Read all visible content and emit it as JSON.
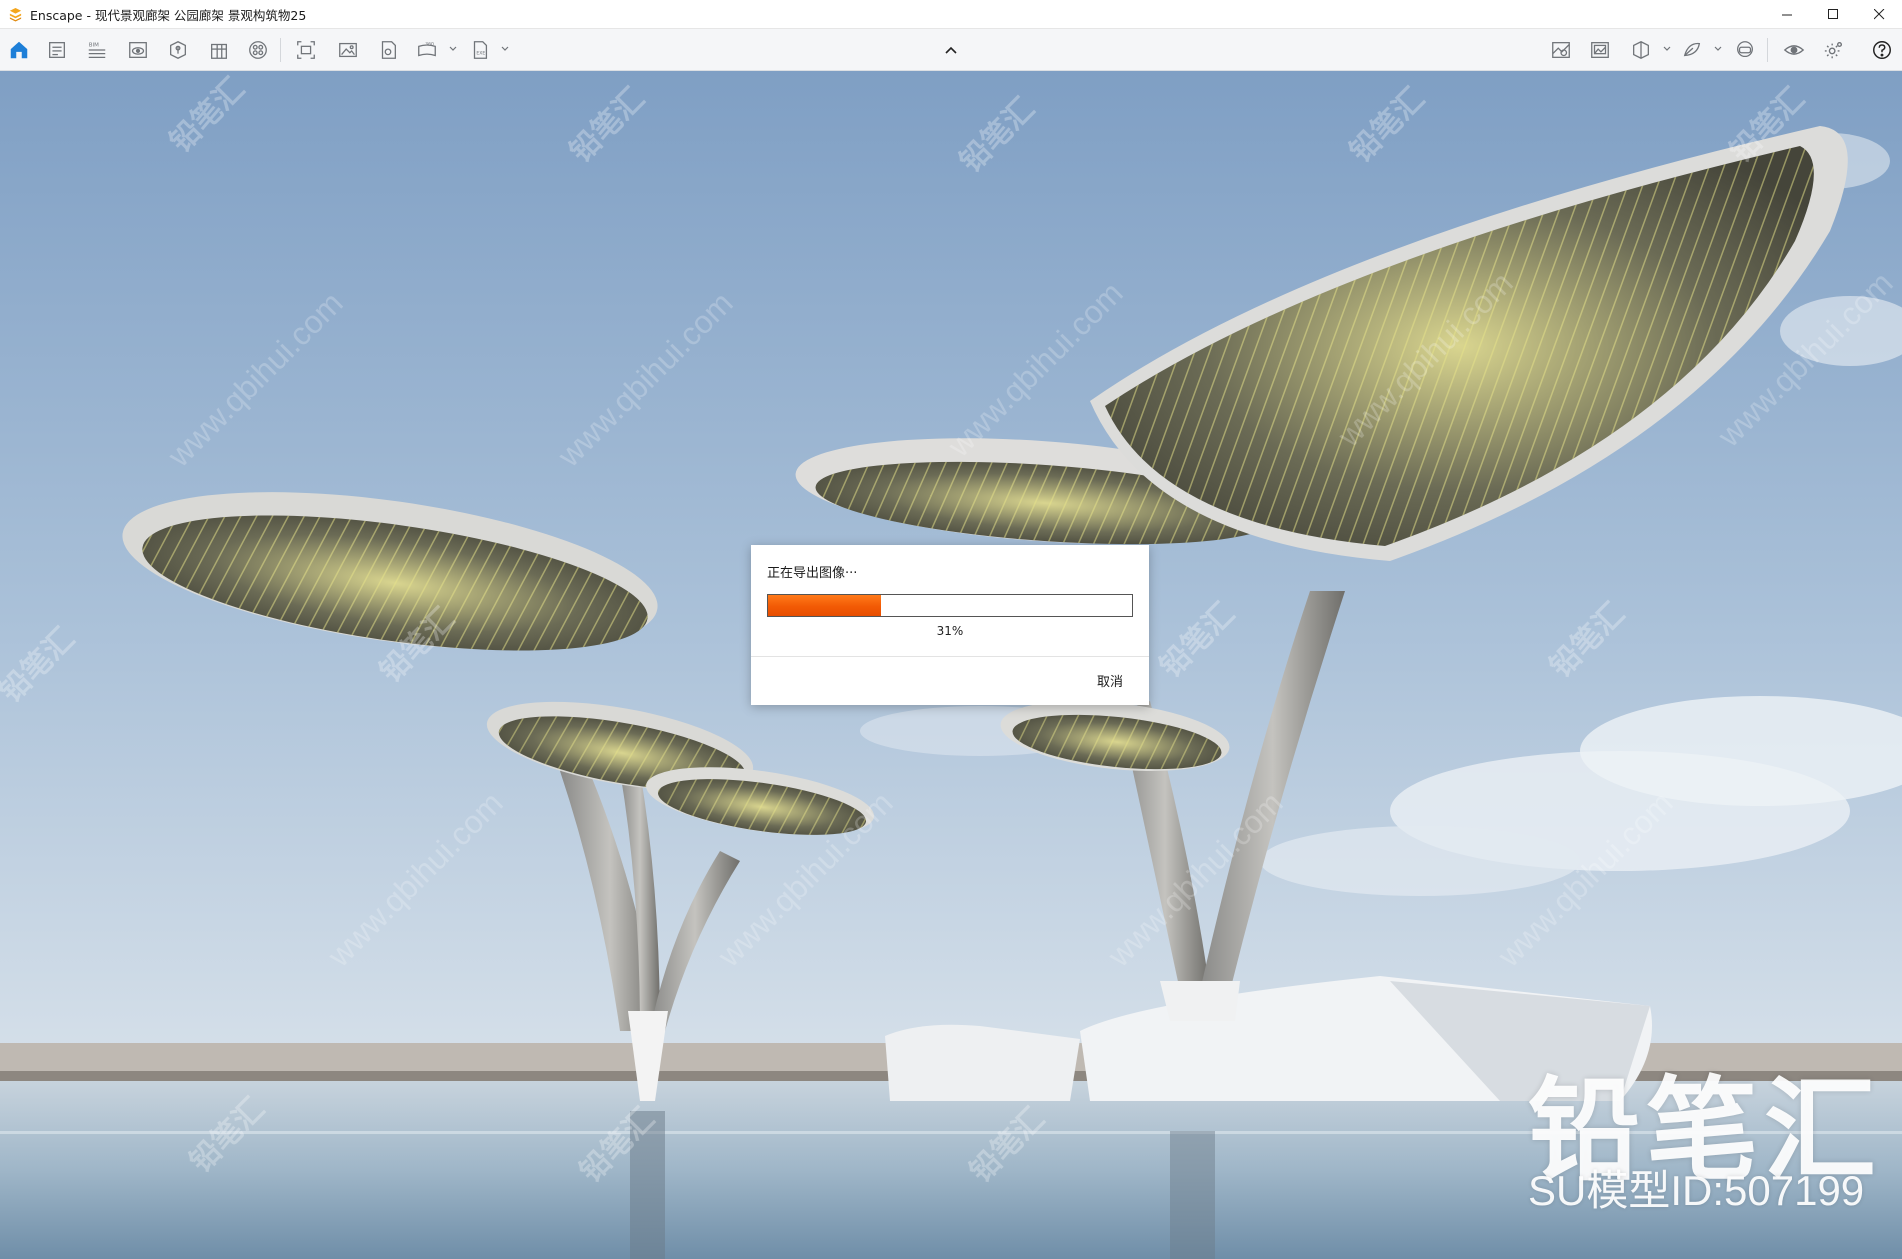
{
  "window": {
    "title": "Enscape - 现代景观廊架 公园廊架 景观构筑物25",
    "controls": [
      "minimize",
      "maximize",
      "close"
    ]
  },
  "toolbar": {
    "left_icons": [
      "home-icon",
      "document-icon",
      "bim-icon",
      "view-icon",
      "asset-library-icon",
      "building-icon",
      "material-icon",
      "batch-render-icon",
      "screenshot-icon",
      "export-panorama-icon",
      "export-video-icon",
      "export-exe-icon"
    ],
    "bim_label": "BIM",
    "right_icons": [
      "view-management-icon",
      "gallery-icon",
      "section-cube-icon",
      "atmosphere-icon",
      "vr-headset-icon",
      "visibility-eye-icon",
      "settings-gear-icon",
      "help-icon"
    ]
  },
  "dialog": {
    "title": "正在导出图像···",
    "progress": 0.31,
    "percent_label": "31%",
    "cancel_label": "取消"
  },
  "watermark": {
    "brand": "铅笔汇",
    "model_id": "SU模型ID:507199",
    "tile_text": "铅笔汇",
    "url_text": "www.qbihui.com"
  },
  "colors": {
    "progress_fill": "#f25a05",
    "home_icon_accent": "#1e7fd8",
    "app_logo": "#f4a61d"
  }
}
